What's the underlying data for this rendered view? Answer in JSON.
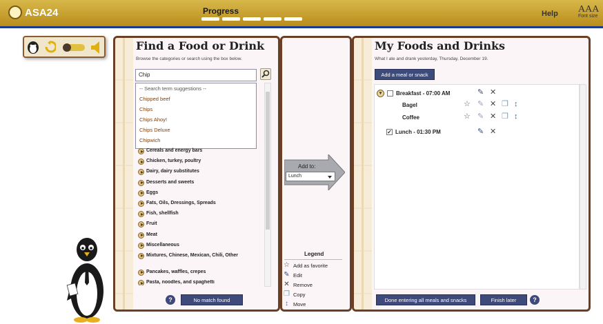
{
  "header": {
    "logo": "ASA24",
    "progress_label": "Progress",
    "help": "Help",
    "font_size_glyphs": "AAA",
    "font_size_label": "Font size"
  },
  "find": {
    "title": "Find a Food or Drink",
    "subtitle": "Browse the categories or search using the box below.",
    "search_value": "Chip",
    "suggestions_header": "-- Search term suggestions --",
    "suggestions": [
      "Chipped beef",
      "Chips",
      "Chips Ahoy!",
      "Chips Deluxe",
      "Chipwich"
    ],
    "categories": [
      "Cereals and energy bars",
      "Chicken, turkey, poultry",
      "Dairy, dairy substitutes",
      "Desserts and sweets",
      "Eggs",
      "Fats, Oils, Dressings, Spreads",
      "Fish, shellfish",
      "Fruit",
      "Meat",
      "Miscellaneous",
      "Mixtures, Chinese, Mexican, Chili, Other",
      "Pancakes, waffles, crepes",
      "Pasta, noodles, and spaghetti"
    ],
    "no_match_button": "No match found",
    "help_glyph": "?"
  },
  "add_to": {
    "label": "Add to:",
    "selected": "Lunch"
  },
  "legend": {
    "title": "Legend",
    "items": [
      {
        "icon": "star-icon",
        "glyph": "☆",
        "label": "Add as favorite"
      },
      {
        "icon": "edit-icon",
        "glyph": "✎",
        "label": "Edit"
      },
      {
        "icon": "remove-icon",
        "glyph": "✕",
        "label": "Remove"
      },
      {
        "icon": "copy-icon",
        "glyph": "❐",
        "label": "Copy"
      },
      {
        "icon": "move-icon",
        "glyph": "↕",
        "label": "Move"
      }
    ]
  },
  "my_foods": {
    "title": "My Foods and Drinks",
    "subtitle": "What I ate and drank yesterday, Thursday, December 19.",
    "add_meal_button": "Add a meal or snack",
    "meals": [
      {
        "name": "Breakfast - 07:00 AM",
        "checked": false,
        "foods": [
          "Bagel",
          "Coffee"
        ]
      },
      {
        "name": "Lunch - 01:30 PM",
        "checked": true,
        "foods": []
      }
    ],
    "done_button": "Done entering all meals and snacks",
    "finish_later_button": "Finish later",
    "help_glyph": "?"
  },
  "colors": {
    "header_gold": "#c9a02c",
    "header_rule": "#1c3a8a",
    "panel_border": "#6b3e26",
    "button_navy": "#3d4a7a",
    "suggestion_text": "#7a3e10"
  }
}
